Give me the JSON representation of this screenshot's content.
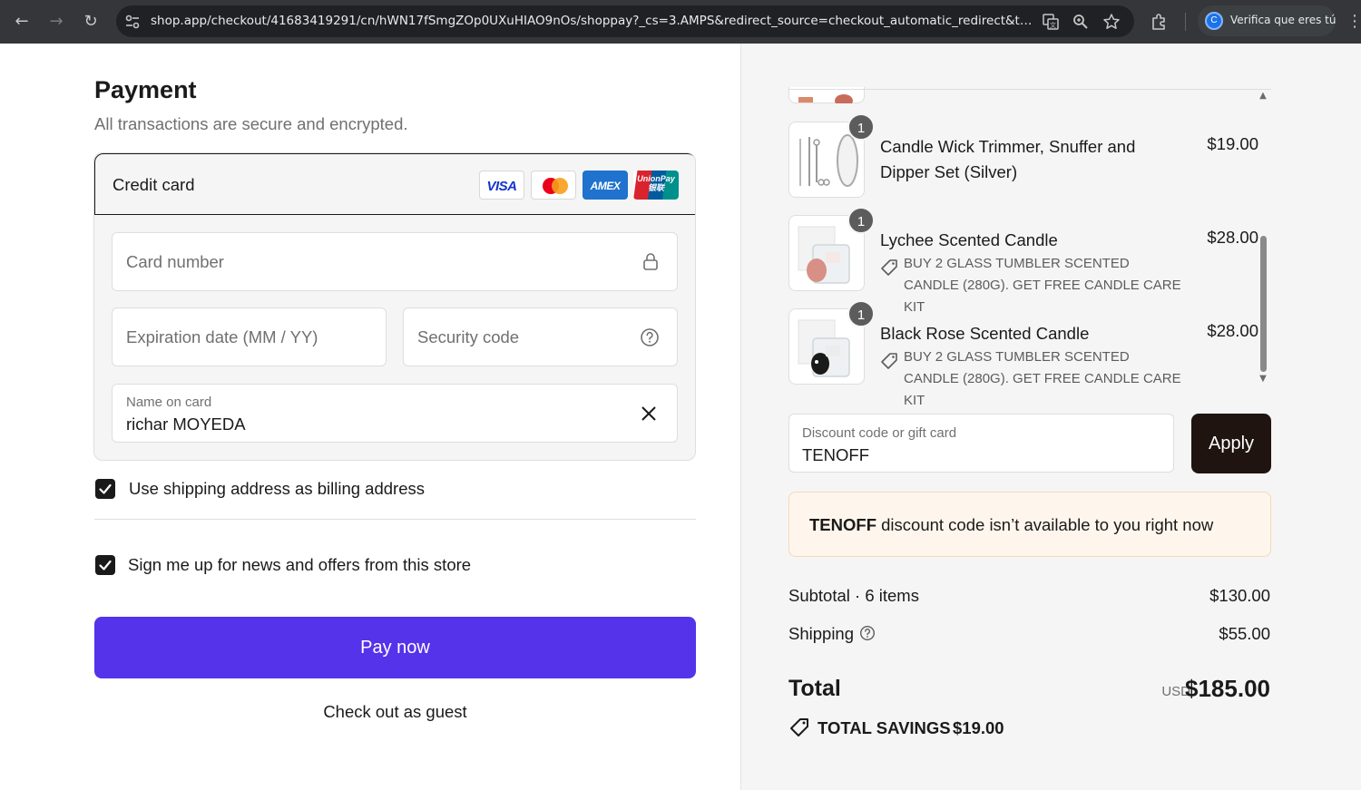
{
  "browser": {
    "url": "shop.app/checkout/41683419291/cn/hWN17fSmgZOp0UXuHIAO9nOs/shoppay?_cs=3.AMPS&redirect_source=checkout_automatic_redirect&tracki...",
    "profile_text": "Verifica que eres tú",
    "profile_initial": "C",
    "back_icon": "arrow-left-icon",
    "forward_icon": "arrow-right-icon",
    "reload_icon": "reload-icon"
  },
  "payment": {
    "title": "Payment",
    "subtitle": "All transactions are secure and encrypted.",
    "method_label": "Credit card",
    "brands": [
      "VISA",
      "mastercard",
      "AMEX",
      "UnionPay 银联"
    ],
    "card_number_placeholder": "Card number",
    "expiration_placeholder": "Expiration date (MM / YY)",
    "security_placeholder": "Security code",
    "name_label": "Name on card",
    "name_value": "richar MOYEDA",
    "billing_checkbox_label": "Use shipping address as billing address",
    "billing_checked": true,
    "news_checkbox_label": "Sign me up for news and offers from this store",
    "news_checked": true,
    "pay_button": "Pay now",
    "guest_link": "Check out as guest",
    "accent_color": "#5433eb"
  },
  "order": {
    "items": [
      {
        "name": "Candle Wick Trimmer, Snuffer and Dipper Set (Silver)",
        "qty": "1",
        "price": "$19.00",
        "discount": ""
      },
      {
        "name": "Lychee Scented Candle",
        "qty": "1",
        "price": "$28.00",
        "discount": "BUY 2 GLASS TUMBLER SCENTED CANDLE (280G). GET FREE CANDLE CARE KIT"
      },
      {
        "name": "Black Rose Scented Candle",
        "qty": "1",
        "price": "$28.00",
        "discount": "BUY 2 GLASS TUMBLER SCENTED CANDLE (280G). GET FREE CANDLE CARE KIT"
      }
    ],
    "discount_label": "Discount code or gift card",
    "discount_value": "TENOFF",
    "apply_button": "Apply",
    "warning_code": "TENOFF",
    "warning_text": " discount code isn’t available to you right now",
    "subtotal_label": "Subtotal · 6 items",
    "subtotal_value": "$130.00",
    "shipping_label": "Shipping",
    "shipping_value": "$55.00",
    "total_label": "Total",
    "total_currency": "USD",
    "total_value": "$185.00",
    "savings_label": "TOTAL SAVINGS",
    "savings_value": "$19.00",
    "apply_color": "#1f140f",
    "warning_bg": "#fef6ec"
  }
}
